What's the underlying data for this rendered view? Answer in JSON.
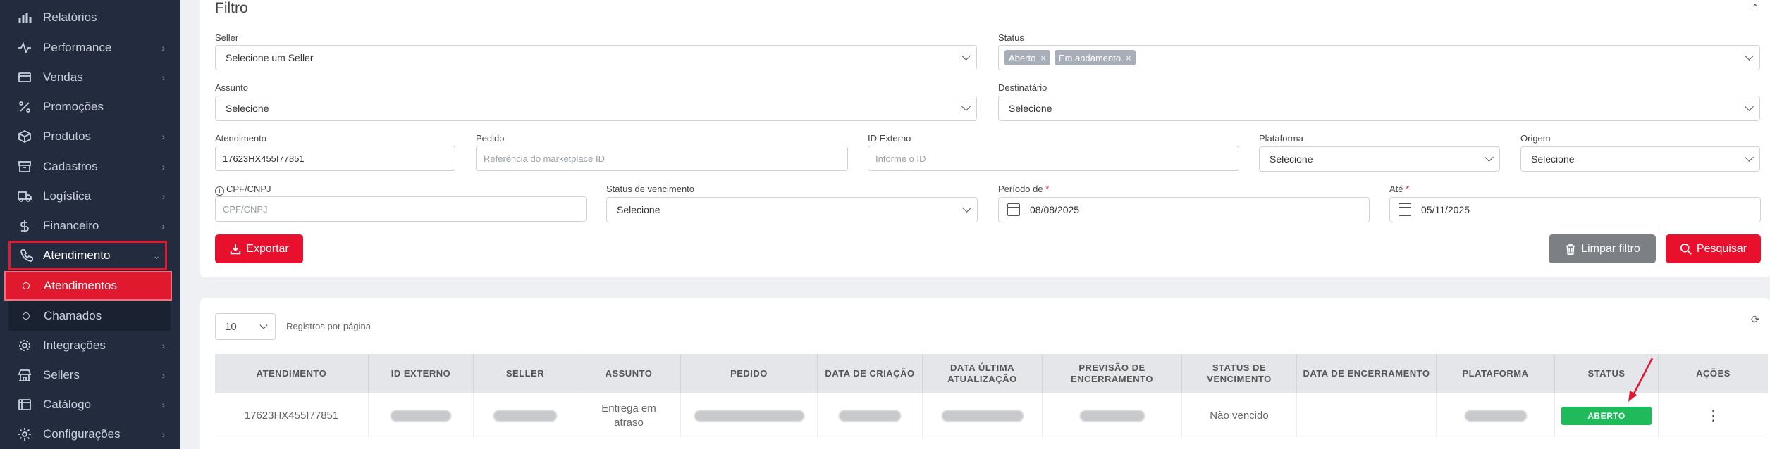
{
  "sidebar": {
    "items": [
      {
        "label": "Relatórios",
        "icon": "bar-chart-icon",
        "chevron": ""
      },
      {
        "label": "Performance",
        "icon": "activity-icon",
        "chevron": "›"
      },
      {
        "label": "Vendas",
        "icon": "wallet-icon",
        "chevron": "›"
      },
      {
        "label": "Promoções",
        "icon": "percent-icon",
        "chevron": ""
      },
      {
        "label": "Produtos",
        "icon": "box-icon",
        "chevron": "›"
      },
      {
        "label": "Cadastros",
        "icon": "archive-icon",
        "chevron": "›"
      },
      {
        "label": "Logística",
        "icon": "truck-icon",
        "chevron": "›"
      },
      {
        "label": "Financeiro",
        "icon": "dollar-icon",
        "chevron": "›"
      },
      {
        "label": "Atendimento",
        "icon": "phone-icon",
        "chevron": "⌄"
      },
      {
        "label": "Integrações",
        "icon": "gear-icon",
        "chevron": "›"
      },
      {
        "label": "Sellers",
        "icon": "store-icon",
        "chevron": "›"
      },
      {
        "label": "Catálogo",
        "icon": "catalog-icon",
        "chevron": "›"
      },
      {
        "label": "Configurações",
        "icon": "settings-icon",
        "chevron": "›"
      }
    ],
    "sub_items": [
      {
        "label": "Atendimentos"
      },
      {
        "label": "Chamados"
      }
    ]
  },
  "filter": {
    "title": "Filtro",
    "collapse_icon": "chevron-up-icon",
    "seller": {
      "label": "Seller",
      "value": "Selecione um Seller"
    },
    "status": {
      "label": "Status",
      "tags": [
        "Aberto",
        "Em andamento"
      ]
    },
    "assunto": {
      "label": "Assunto",
      "value": "Selecione"
    },
    "destinatario": {
      "label": "Destinatário",
      "value": "Selecione"
    },
    "atendimento": {
      "label": "Atendimento",
      "value": "17623HX455I77851"
    },
    "pedido": {
      "label": "Pedido",
      "placeholder": "Referência do marketplace ID"
    },
    "id_externo": {
      "label": "ID Externo",
      "placeholder": "Informe o ID"
    },
    "plataforma": {
      "label": "Plataforma",
      "value": "Selecione"
    },
    "origem": {
      "label": "Origem",
      "value": "Selecione"
    },
    "cpf": {
      "label": "CPF/CNPJ",
      "placeholder": "CPF/CNPJ"
    },
    "status_vencimento": {
      "label": "Status de vencimento",
      "value": "Selecione"
    },
    "periodo_de": {
      "label": "Período de",
      "value": "08/08/2025"
    },
    "ate": {
      "label": "Até",
      "value": "05/11/2025"
    },
    "required_mark": "*",
    "export_label": "Exportar",
    "clear_label": "Limpar filtro",
    "search_label": "Pesquisar"
  },
  "table": {
    "per_page": "10",
    "per_page_label": "Registros por página",
    "columns": [
      "ATENDIMENTO",
      "ID EXTERNO",
      "SELLER",
      "ASSUNTO",
      "PEDIDO",
      "DATA DE CRIAÇÃO",
      "DATA ÚLTIMA ATUALIZAÇÃO",
      "PREVISÃO DE ENCERRAMENTO",
      "STATUS DE VENCIMENTO",
      "DATA DE ENCERRAMENTO",
      "PLATAFORMA",
      "STATUS",
      "AÇÕES"
    ],
    "rows": [
      {
        "atendimento": "17623HX455I77851",
        "assunto": "Entrega em atraso",
        "status_vencimento": "Não vencido",
        "status": "ABERTO"
      }
    ]
  },
  "colors": {
    "accent": "#e8102c",
    "sidebar": "#232b3e",
    "status_open": "#1fba5a"
  }
}
